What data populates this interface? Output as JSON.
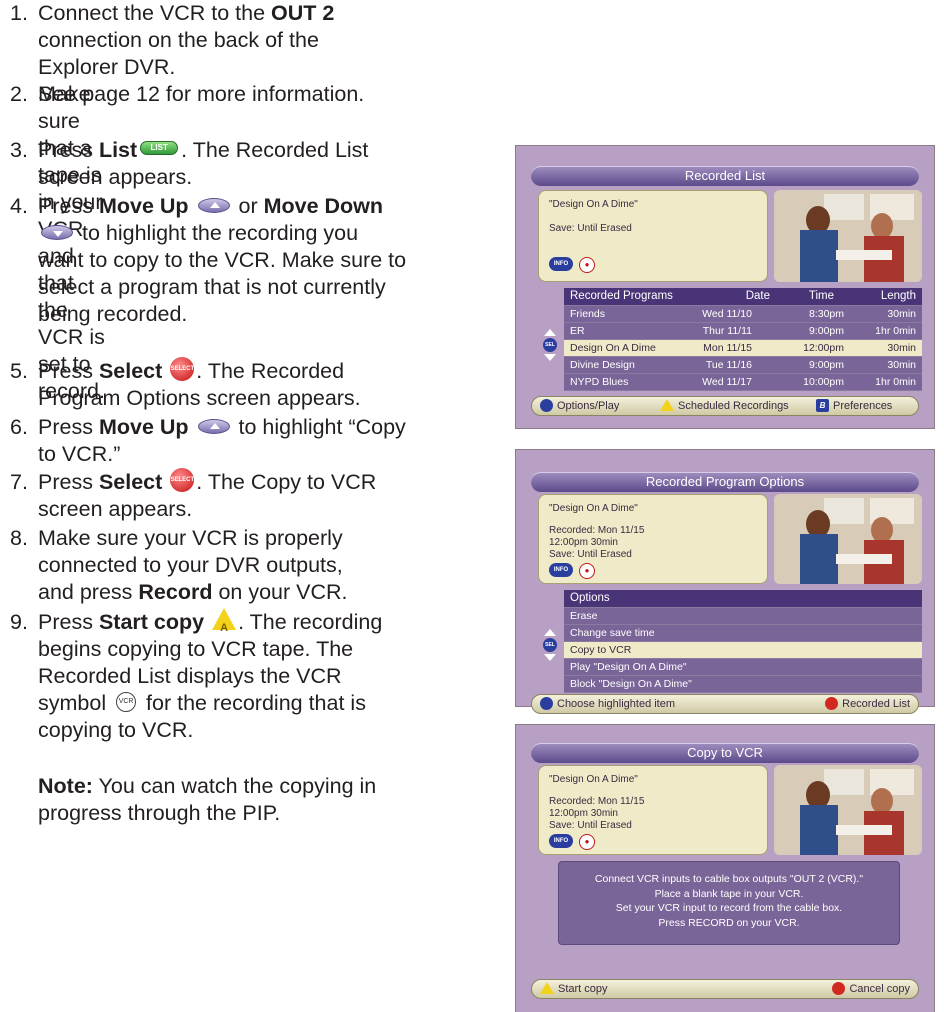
{
  "steps": [
    {
      "num": "1.",
      "line1_a": "Connect the VCR to the ",
      "line1_b": "OUT 2",
      "line1_c": " connection on the back of the Explorer DVR.",
      "line2": "See page 12 for more information."
    },
    {
      "num": "2.",
      "text": "Make sure that a tape is in your VCR and that the VCR is set to record."
    },
    {
      "num": "3.",
      "pre": "Press ",
      "bold": "List",
      "post": ". The Recorded List",
      "line2": "screen appears.",
      "icon": "list-button-icon",
      "icon_label": "LIST"
    },
    {
      "num": "4.",
      "pre": "Press ",
      "bold1": "Move Up",
      "mid": " or ",
      "bold2": "Move Down",
      "line2": "to highlight the recording you",
      "line3": "want to copy to the VCR. Make sure to",
      "line4": "select a program that is not currently",
      "line5": "being recorded."
    },
    {
      "num": "5.",
      "pre": "Press ",
      "bold": "Select",
      "post": ". The Recorded",
      "line2": "Program Options screen appears.",
      "icon_label": "SELECT"
    },
    {
      "num": "6.",
      "pre": "Press ",
      "bold": "Move Up",
      "post": " to highlight “Copy",
      "line2": "to VCR.”"
    },
    {
      "num": "7.",
      "pre": "Press ",
      "bold": "Select",
      "post": ". The Copy to VCR",
      "line2": "screen appears.",
      "icon_label": "SELECT"
    },
    {
      "num": "8.",
      "line1": "Make sure your VCR is properly",
      "line2": "connected to your DVR outputs,",
      "line3_pre": "and press ",
      "line3_bold": "Record",
      "line3_post": " on your VCR."
    },
    {
      "num": "9.",
      "pre": "Press ",
      "bold": "Start copy",
      "post": ". The recording",
      "line2": "begins copying to VCR tape. The",
      "line3": "Recorded List displays the VCR",
      "line4_pre": "symbol ",
      "line4_post": " for the recording that is",
      "line5": "copying to VCR.",
      "a_label": "A",
      "vcr_label": "VCR"
    }
  ],
  "note": {
    "bold": "Note:",
    "text": " You can watch the copying in",
    "line2": "progress through the PIP."
  },
  "screen1": {
    "title": "Recorded List",
    "program": "\"Design On A Dime\"",
    "save": "Save: Until Erased",
    "info_label": "INFO",
    "headers": [
      "Recorded Programs",
      "Date",
      "Time",
      "Length"
    ],
    "rows": [
      [
        "Friends",
        "Wed  11/10",
        "8:30pm",
        "30min"
      ],
      [
        "ER",
        "Thur  11/11",
        "9:00pm",
        "1hr  0min"
      ],
      [
        "Design On A Dime",
        "Mon  11/15",
        "12:00pm",
        "30min"
      ],
      [
        "Divine Design",
        "Tue  11/16",
        "9:00pm",
        "30min"
      ],
      [
        "NYPD Blues",
        "Wed  11/17",
        "10:00pm",
        "1hr  0min"
      ]
    ],
    "selected_row": 2,
    "sel_label": "SEL",
    "footer": [
      "Options/Play",
      "Scheduled Recordings",
      "Preferences"
    ],
    "footer_b": "B"
  },
  "screen2": {
    "title": "Recorded Program Options",
    "program": "\"Design On A Dime\"",
    "recorded": "Recorded: Mon 11/15",
    "time": "12:00pm  30min",
    "save": "Save: Until Erased",
    "info_label": "INFO",
    "header": "Options",
    "rows": [
      "Erase",
      "Change save time",
      "Copy to VCR",
      "Play \"Design On A Dime\"",
      "Block \"Design On A Dime\""
    ],
    "selected_row": 2,
    "sel_label": "SEL",
    "footer": [
      "Choose highlighted item",
      "Recorded List"
    ]
  },
  "screen3": {
    "title": "Copy to VCR",
    "program": "\"Design On A Dime\"",
    "recorded": "Recorded: Mon 11/15",
    "time": "12:00pm  30min",
    "save": "Save: Until Erased",
    "info_label": "INFO",
    "message": [
      "Connect VCR inputs to cable box outputs \"OUT 2 (VCR).\"",
      "Place a blank tape in your VCR.",
      "Set your VCR input to record from the cable box.",
      "Press RECORD on your VCR."
    ],
    "footer": [
      "Start copy",
      "Cancel copy"
    ]
  }
}
